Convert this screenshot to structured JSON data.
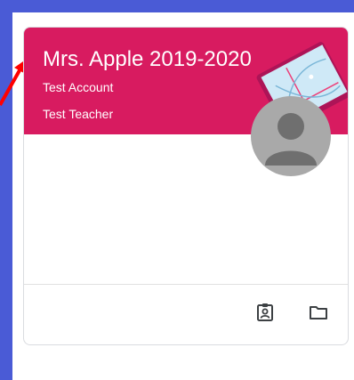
{
  "class_card": {
    "title": "Mrs. Apple 2019-2020",
    "section": "Test Account",
    "teacher": "Test Teacher",
    "header_color": "#d81b60",
    "icons": [
      "assignment-ind-icon",
      "folder-icon"
    ]
  },
  "colors": {
    "page_background": "#4a5bd6",
    "annotation_arrow": "#ff0000"
  }
}
